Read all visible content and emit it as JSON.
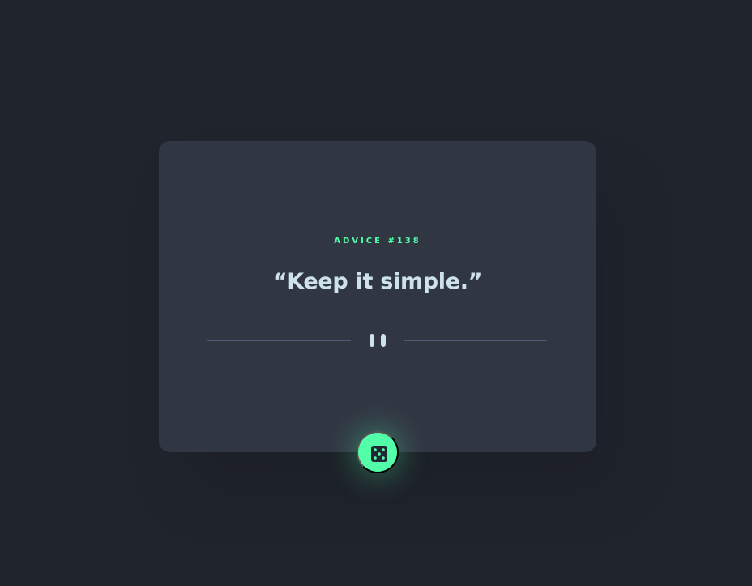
{
  "card": {
    "advice_label": "ADVICE #138",
    "quote": "“Keep it simple.”"
  },
  "icons": {
    "divider": "pause-icon",
    "button": "dice-icon"
  },
  "colors": {
    "background": "#20242d",
    "card": "#313643",
    "accent": "#52ffa8",
    "quote_text": "#cee3e9",
    "divider": "#4f5d74"
  }
}
